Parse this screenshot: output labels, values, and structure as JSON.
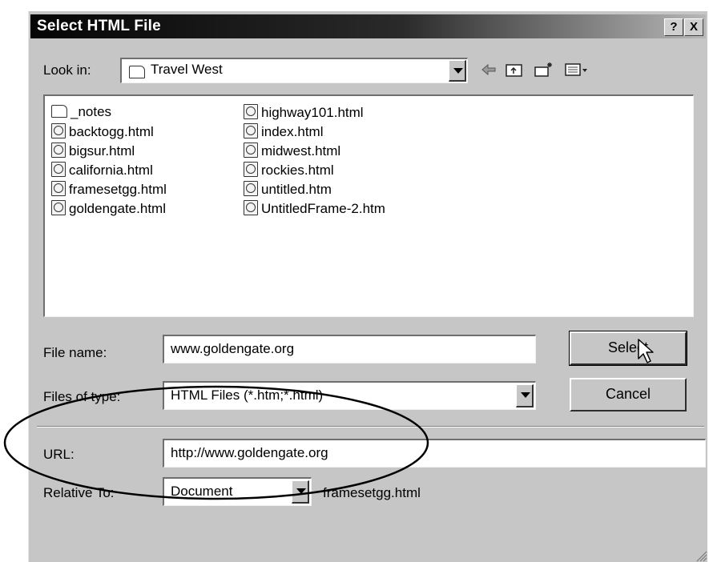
{
  "dialog": {
    "title": "Select HTML File",
    "help_label": "?",
    "close_label": "X"
  },
  "lookin": {
    "label": "Look in:",
    "value": "Travel West"
  },
  "toolbar": {
    "back_icon": "back-arrow-icon",
    "up_icon": "up-folder-icon",
    "new_folder_icon": "new-folder-icon",
    "view_icon": "view-menu-icon"
  },
  "files": [
    {
      "name": "_notes",
      "type": "folder"
    },
    {
      "name": "backtogg.html",
      "type": "doc"
    },
    {
      "name": "bigsur.html",
      "type": "doc"
    },
    {
      "name": "california.html",
      "type": "doc"
    },
    {
      "name": "framesetgg.html",
      "type": "doc"
    },
    {
      "name": "goldengate.html",
      "type": "doc"
    },
    {
      "name": "highway101.html",
      "type": "doc"
    },
    {
      "name": "index.html",
      "type": "doc"
    },
    {
      "name": "midwest.html",
      "type": "doc"
    },
    {
      "name": "rockies.html",
      "type": "doc"
    },
    {
      "name": "untitled.htm",
      "type": "doc"
    },
    {
      "name": "UntitledFrame-2.htm",
      "type": "doc"
    }
  ],
  "filename": {
    "label": "File name:",
    "value": "www.goldengate.org"
  },
  "filetype": {
    "label": "Files of type:",
    "value": "HTML Files (*.htm;*.html)"
  },
  "buttons": {
    "select": "Select",
    "cancel": "Cancel"
  },
  "url": {
    "label": "URL:",
    "value": "http://www.goldengate.org"
  },
  "relative": {
    "label": "Relative To:",
    "value": "Document",
    "file": "framesetgg.html"
  }
}
